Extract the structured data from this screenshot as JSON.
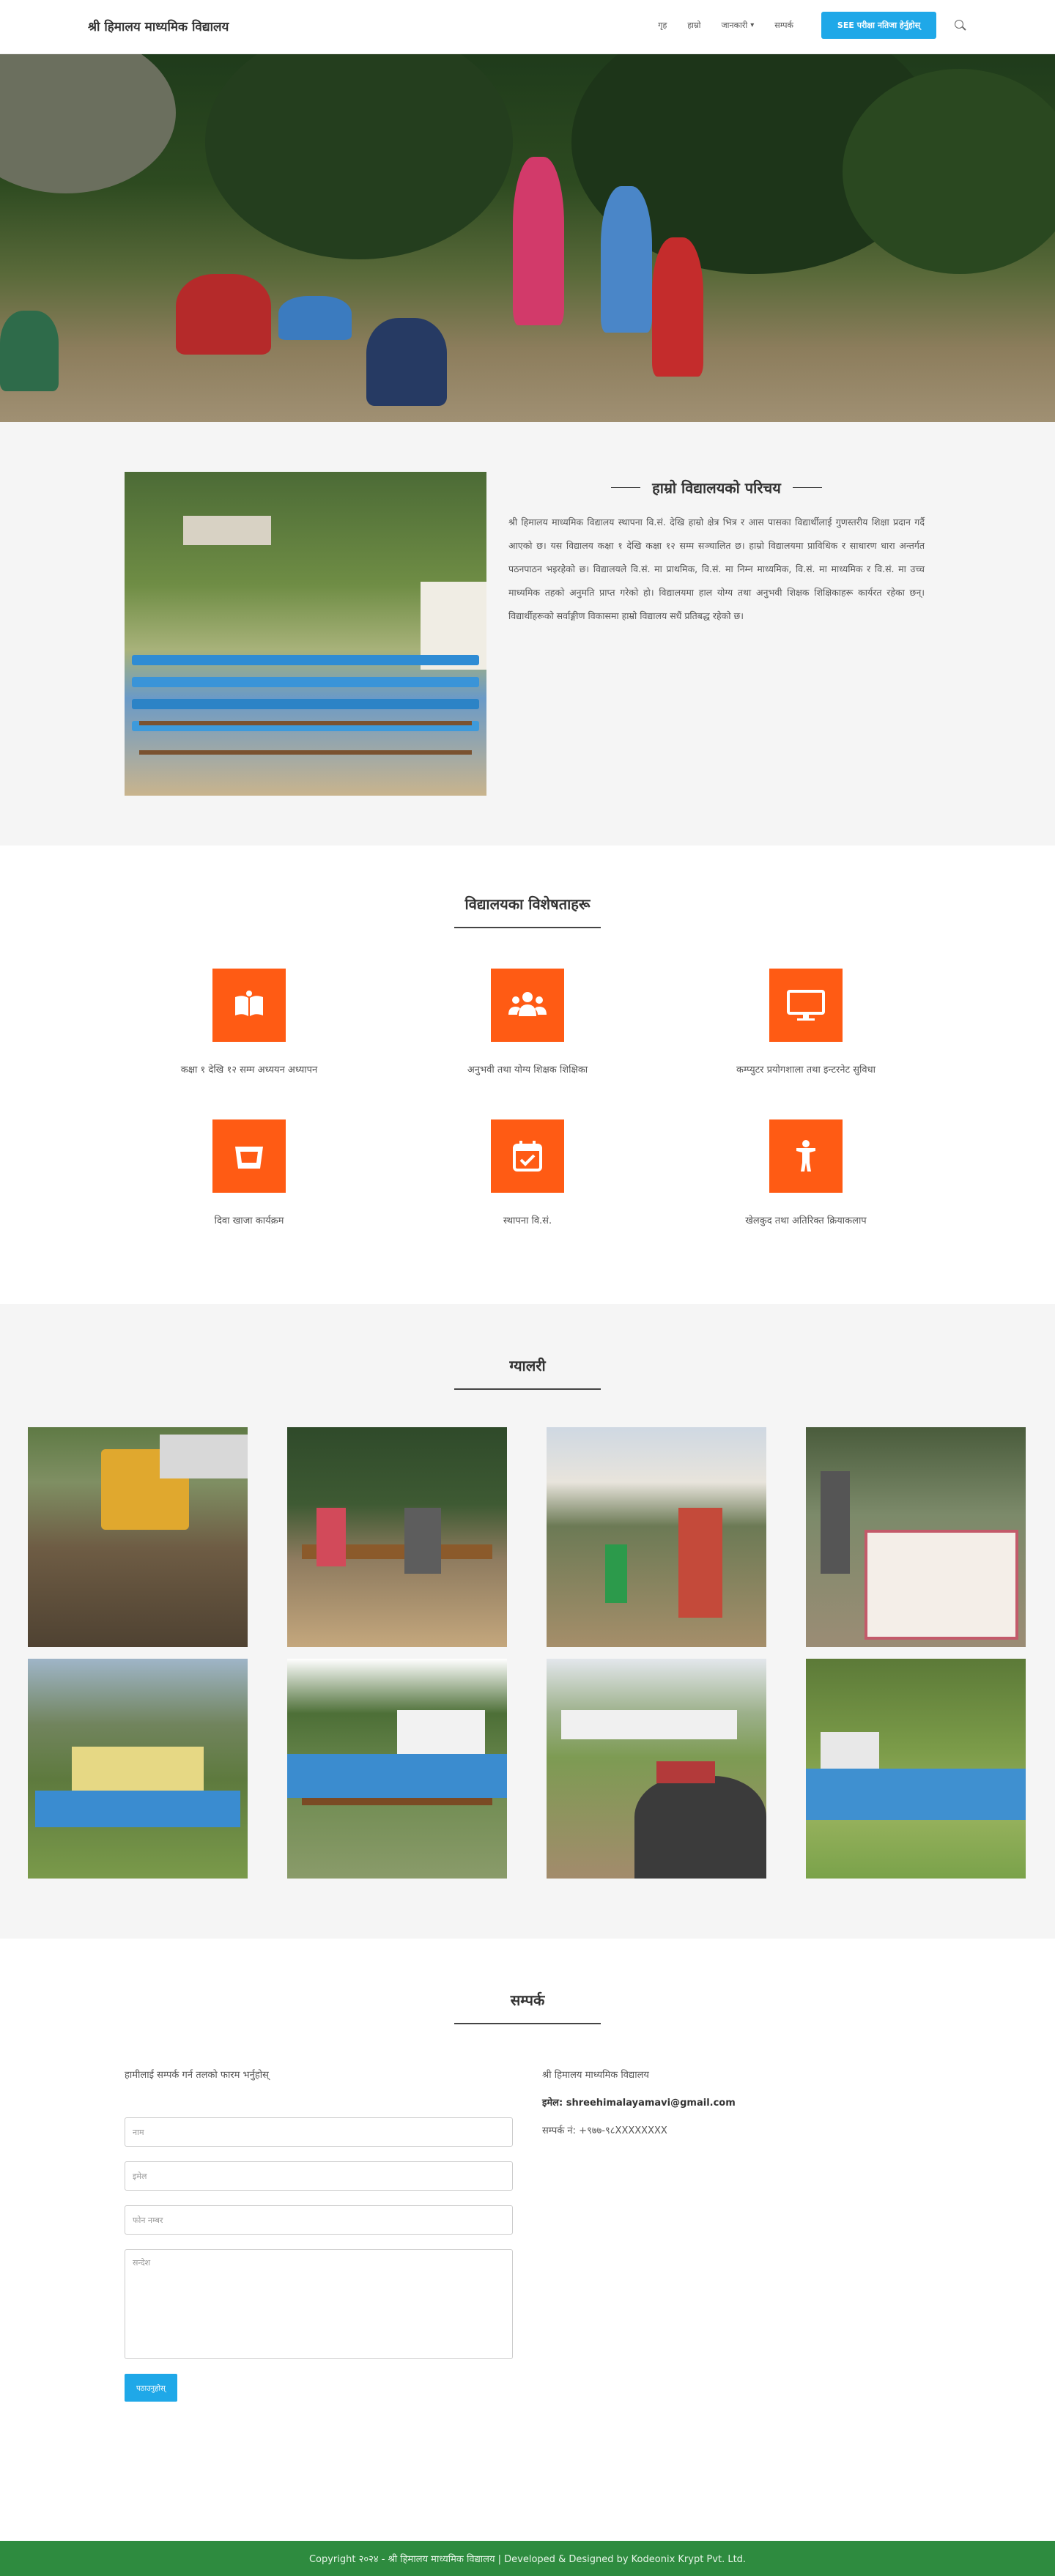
{
  "header": {
    "brand": "श्री हिमालय माध्यमिक विद्यालय",
    "nav": [
      "गृह",
      "हाम्रो",
      "जानकारी",
      "सम्पर्क"
    ],
    "dropdown_index": 2,
    "cta": "SEE परीक्षा नतिजा हेर्नुहोस्"
  },
  "about": {
    "title": "हाम्रो विद्यालयको परिचय",
    "body": "श्री हिमालय माध्यमिक विद्यालय स्थापना वि.सं. देखि हाम्रो क्षेत्र भित्र र आस पासका विद्यार्थीलाई गुणस्तरीय शिक्षा प्रदान गर्दै आएको छ। यस विद्यालय कक्षा १ देखि कक्षा १२ सम्म सञ्चालित छ। हाम्रो विद्यालयमा प्राविधिक र साधारण धारा अन्तर्गत पठनपाठन भइरहेको छ। विद्यालयले वि.सं. मा प्राथमिक, वि.सं. मा निम्न माध्यमिक, वि.सं. मा माध्यमिक र वि.सं. मा उच्च माध्यमिक तहको अनुमति प्राप्त गरेको हो। विद्यालयमा हाल योग्य तथा अनुभवी शिक्षक शिक्षिकाहरू कार्यरत रहेका छन्। विद्यार्थीहरूको सर्वाङ्गीण विकासमा हाम्रो विद्यालय सधैं प्रतिबद्ध रहेको छ।"
  },
  "features": {
    "title": "विद्यालयका विशेषताहरू",
    "items": [
      {
        "icon": "book-icon",
        "label": "कक्षा १ देखि १२ सम्म अध्ययन अध्यापन"
      },
      {
        "icon": "users-icon",
        "label": "अनुभवी तथा योग्य शिक्षक शिक्षिका"
      },
      {
        "icon": "monitor-icon",
        "label": "कम्प्युटर प्रयोगशाला तथा इन्टरनेट सुविधा"
      },
      {
        "icon": "basket-icon",
        "label": "दिवा खाजा कार्यक्रम"
      },
      {
        "icon": "calendar-icon",
        "label": "स्थापना वि.सं."
      },
      {
        "icon": "person-icon",
        "label": "खेलकुद तथा अतिरिक्त क्रियाकलाप"
      }
    ]
  },
  "gallery": {
    "title": "ग्यालरी",
    "images": [
      {
        "name": "excavator-photo"
      },
      {
        "name": "meeting-under-tree-photo"
      },
      {
        "name": "guests-seated-photo"
      },
      {
        "name": "banner-program-photo"
      },
      {
        "name": "school-building-students-photo"
      },
      {
        "name": "assembly-photo"
      },
      {
        "name": "elders-ground-photo"
      },
      {
        "name": "students-field-photo"
      }
    ]
  },
  "contact": {
    "title": "सम्पर्क",
    "intro": "हामीलाई सम्पर्क गर्न तलको फारम भर्नुहोस्",
    "fields": {
      "name": "नाम",
      "email": "इमेल",
      "phone": "फोन नम्बर",
      "message": "सन्देश"
    },
    "send": "पठाउनुहोस्",
    "info": {
      "school": "श्री हिमालय माध्यमिक विद्यालय",
      "email_label": "इमेल",
      "email": "shreehimalayamavi@gmail.com",
      "phone_label": "सम्पर्क नं",
      "phone": "+९७७-९८XXXXXXXX"
    }
  },
  "footer": {
    "text": "Copyright २०२४ - श्री हिमालय माध्यमिक विद्यालय | Developed & Designed by Kodeonix Krypt Pvt. Ltd."
  },
  "colors": {
    "accent": "#1fa8e8",
    "feature_tile": "#ff5b14",
    "footer": "#2e8b3f"
  }
}
